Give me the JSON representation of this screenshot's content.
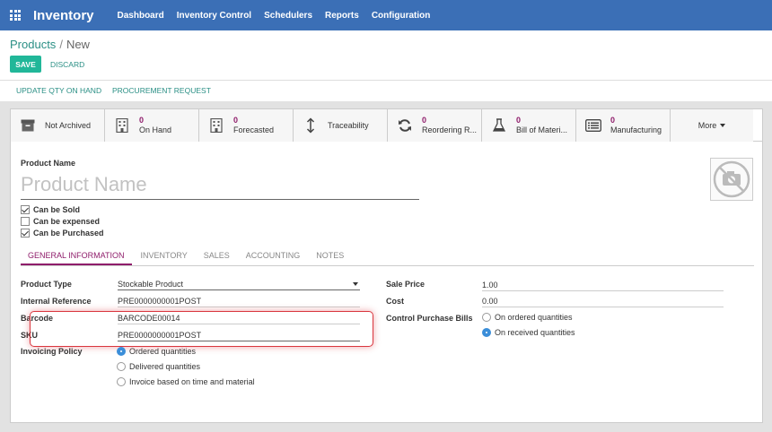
{
  "app": {
    "title": "Inventory"
  },
  "nav": [
    "Dashboard",
    "Inventory Control",
    "Schedulers",
    "Reports",
    "Configuration"
  ],
  "breadcrumb": {
    "parent": "Products",
    "separator": "/",
    "current": "New"
  },
  "buttons": {
    "save": "SAVE",
    "discard": "DISCARD"
  },
  "actions": {
    "update_qty": "UPDATE QTY ON HAND",
    "procurement": "PROCUREMENT REQUEST"
  },
  "smart_buttons": {
    "archived": {
      "label": "Not Archived",
      "icon": "archive-icon"
    },
    "on_hand": {
      "count": "0",
      "label": "On Hand",
      "icon": "building-icon"
    },
    "forecasted": {
      "count": "0",
      "label": "Forecasted",
      "icon": "building-icon"
    },
    "traceability": {
      "label": "Traceability",
      "icon": "updown-arrow-icon"
    },
    "reordering": {
      "count": "0",
      "label": "Reordering R...",
      "icon": "refresh-icon"
    },
    "bom": {
      "count": "0",
      "label": "Bill of Materi...",
      "icon": "flask-icon"
    },
    "manufacturing": {
      "count": "0",
      "label": "Manufacturing",
      "icon": "list-icon"
    },
    "more": {
      "label": "More"
    }
  },
  "product": {
    "name_label": "Product Name",
    "name_placeholder": "Product Name",
    "can_be_sold": "Can be Sold",
    "can_be_expensed": "Can be expensed",
    "can_be_purchased": "Can be Purchased"
  },
  "checks": {
    "sold": true,
    "expensed": false,
    "purchased": true
  },
  "tabs": [
    "GENERAL INFORMATION",
    "INVENTORY",
    "SALES",
    "ACCOUNTING",
    "NOTES"
  ],
  "form": {
    "product_type": {
      "label": "Product Type",
      "value": "Stockable Product"
    },
    "internal_ref": {
      "label": "Internal Reference",
      "value": "PRE0000000001POST"
    },
    "barcode": {
      "label": "Barcode",
      "value": "BARCODE00014"
    },
    "sku": {
      "label": "SKU",
      "value": "PRE0000000001POST"
    },
    "invoicing_policy": {
      "label": "Invoicing Policy",
      "options": [
        "Ordered quantities",
        "Delivered quantities",
        "Invoice based on time and material"
      ],
      "selected": "Ordered quantities"
    },
    "sale_price": {
      "label": "Sale Price",
      "value": "1.00"
    },
    "cost": {
      "label": "Cost",
      "value": "0.00"
    },
    "control_purchase_bills": {
      "label": "Control Purchase Bills",
      "options": [
        "On ordered quantities",
        "On received quantities"
      ],
      "selected": "On received quantities"
    }
  },
  "colors": {
    "nav": "#3b6fb6",
    "accent": "#21b799",
    "link": "#2a8f85",
    "count": "#8f1d6b",
    "highlight": "#d9363e"
  }
}
